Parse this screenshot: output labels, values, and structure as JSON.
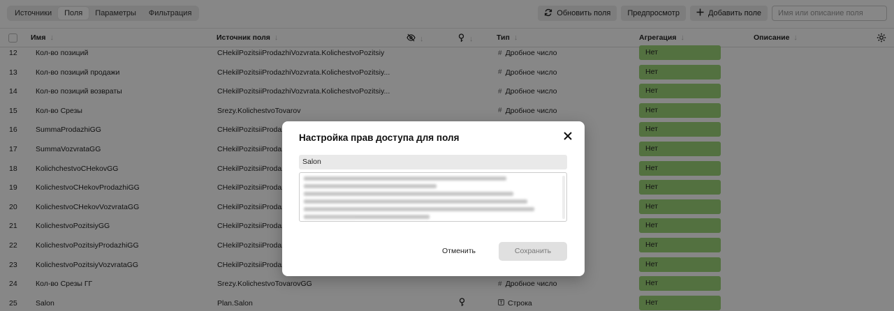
{
  "tabs": [
    "Источники",
    "Поля",
    "Параметры",
    "Фильтрация"
  ],
  "toolbar": {
    "refresh_label": "Обновить поля",
    "preview_label": "Предпросмотр",
    "add_label": "Добавить поле",
    "search_placeholder": "Имя или описание поля"
  },
  "columns": {
    "name": "Имя",
    "source": "Источник поля",
    "type": "Тип",
    "aggregation": "Агрегация",
    "description": "Описание"
  },
  "rows": [
    {
      "num": "12",
      "name": "Кол-во позиций",
      "source": "CHekilPozitsiiProdazhiVozvrata.KolichestvoPozitsiy",
      "type": "Дробное число",
      "agg": "Нет"
    },
    {
      "num": "13",
      "name": "Кол-во позиций продажи",
      "source": "CHekilPozitsiiProdazhiVozvrata.KolichestvoPozitsiy...",
      "type": "Дробное число",
      "agg": "Нет"
    },
    {
      "num": "14",
      "name": "Кол-во позиций возвраты",
      "source": "CHekilPozitsiiProdazhiVozvrata.KolichestvoPozitsiy...",
      "type": "Дробное число",
      "agg": "Нет"
    },
    {
      "num": "15",
      "name": "Кол-во Срезы",
      "source": "Srezy.KolichestvoTovarov",
      "type": "Дробное число",
      "agg": "Нет"
    },
    {
      "num": "16",
      "name": "SummaProdazhiGG",
      "source": "CHekilPozitsiiProdazhiV",
      "type": "",
      "agg": "Нет"
    },
    {
      "num": "17",
      "name": "SummaVozvrataGG",
      "source": "CHekilPozitsiiProdazhiV",
      "type": "",
      "agg": "Нет"
    },
    {
      "num": "18",
      "name": "KolichchestvoCHekovGG",
      "source": "CHekilPozitsiiProdazhiV",
      "type": "",
      "agg": "Нет"
    },
    {
      "num": "19",
      "name": "KolichestvoCHekovProdazhiGG",
      "source": "CHekilPozitsiiProdazhiV",
      "type": "",
      "agg": "Нет"
    },
    {
      "num": "20",
      "name": "KolichestvoCHekovVozvrataGG",
      "source": "CHekilPozitsiiProdazhiV",
      "type": "",
      "agg": "Нет"
    },
    {
      "num": "21",
      "name": "KolichestvoPozitsiyGG",
      "source": "CHekilPozitsiiProdazhiV",
      "type": "",
      "agg": "Нет"
    },
    {
      "num": "22",
      "name": "KolichestvoPozitsiyProdazhiGG",
      "source": "CHekilPozitsiiProdazhiV",
      "type": "",
      "agg": "Нет"
    },
    {
      "num": "23",
      "name": "KolichestvoPozitsiyVozvrataGG",
      "source": "CHekilPozitsiiProdazhiV",
      "type": "",
      "agg": "Нет"
    },
    {
      "num": "24",
      "name": "Кол-во Срезы ГГ",
      "source": "Srezy.KolichestvoTovarovGG",
      "type": "Дробное число",
      "agg": "Нет"
    },
    {
      "num": "25",
      "name": "Salon",
      "source": "Plan.Salon",
      "type": "Строка",
      "agg": "Нет"
    }
  ],
  "modal": {
    "title": "Настройка прав доступа для поля",
    "field_value": "Salon",
    "cancel_label": "Отменить",
    "save_label": "Сохранить"
  }
}
